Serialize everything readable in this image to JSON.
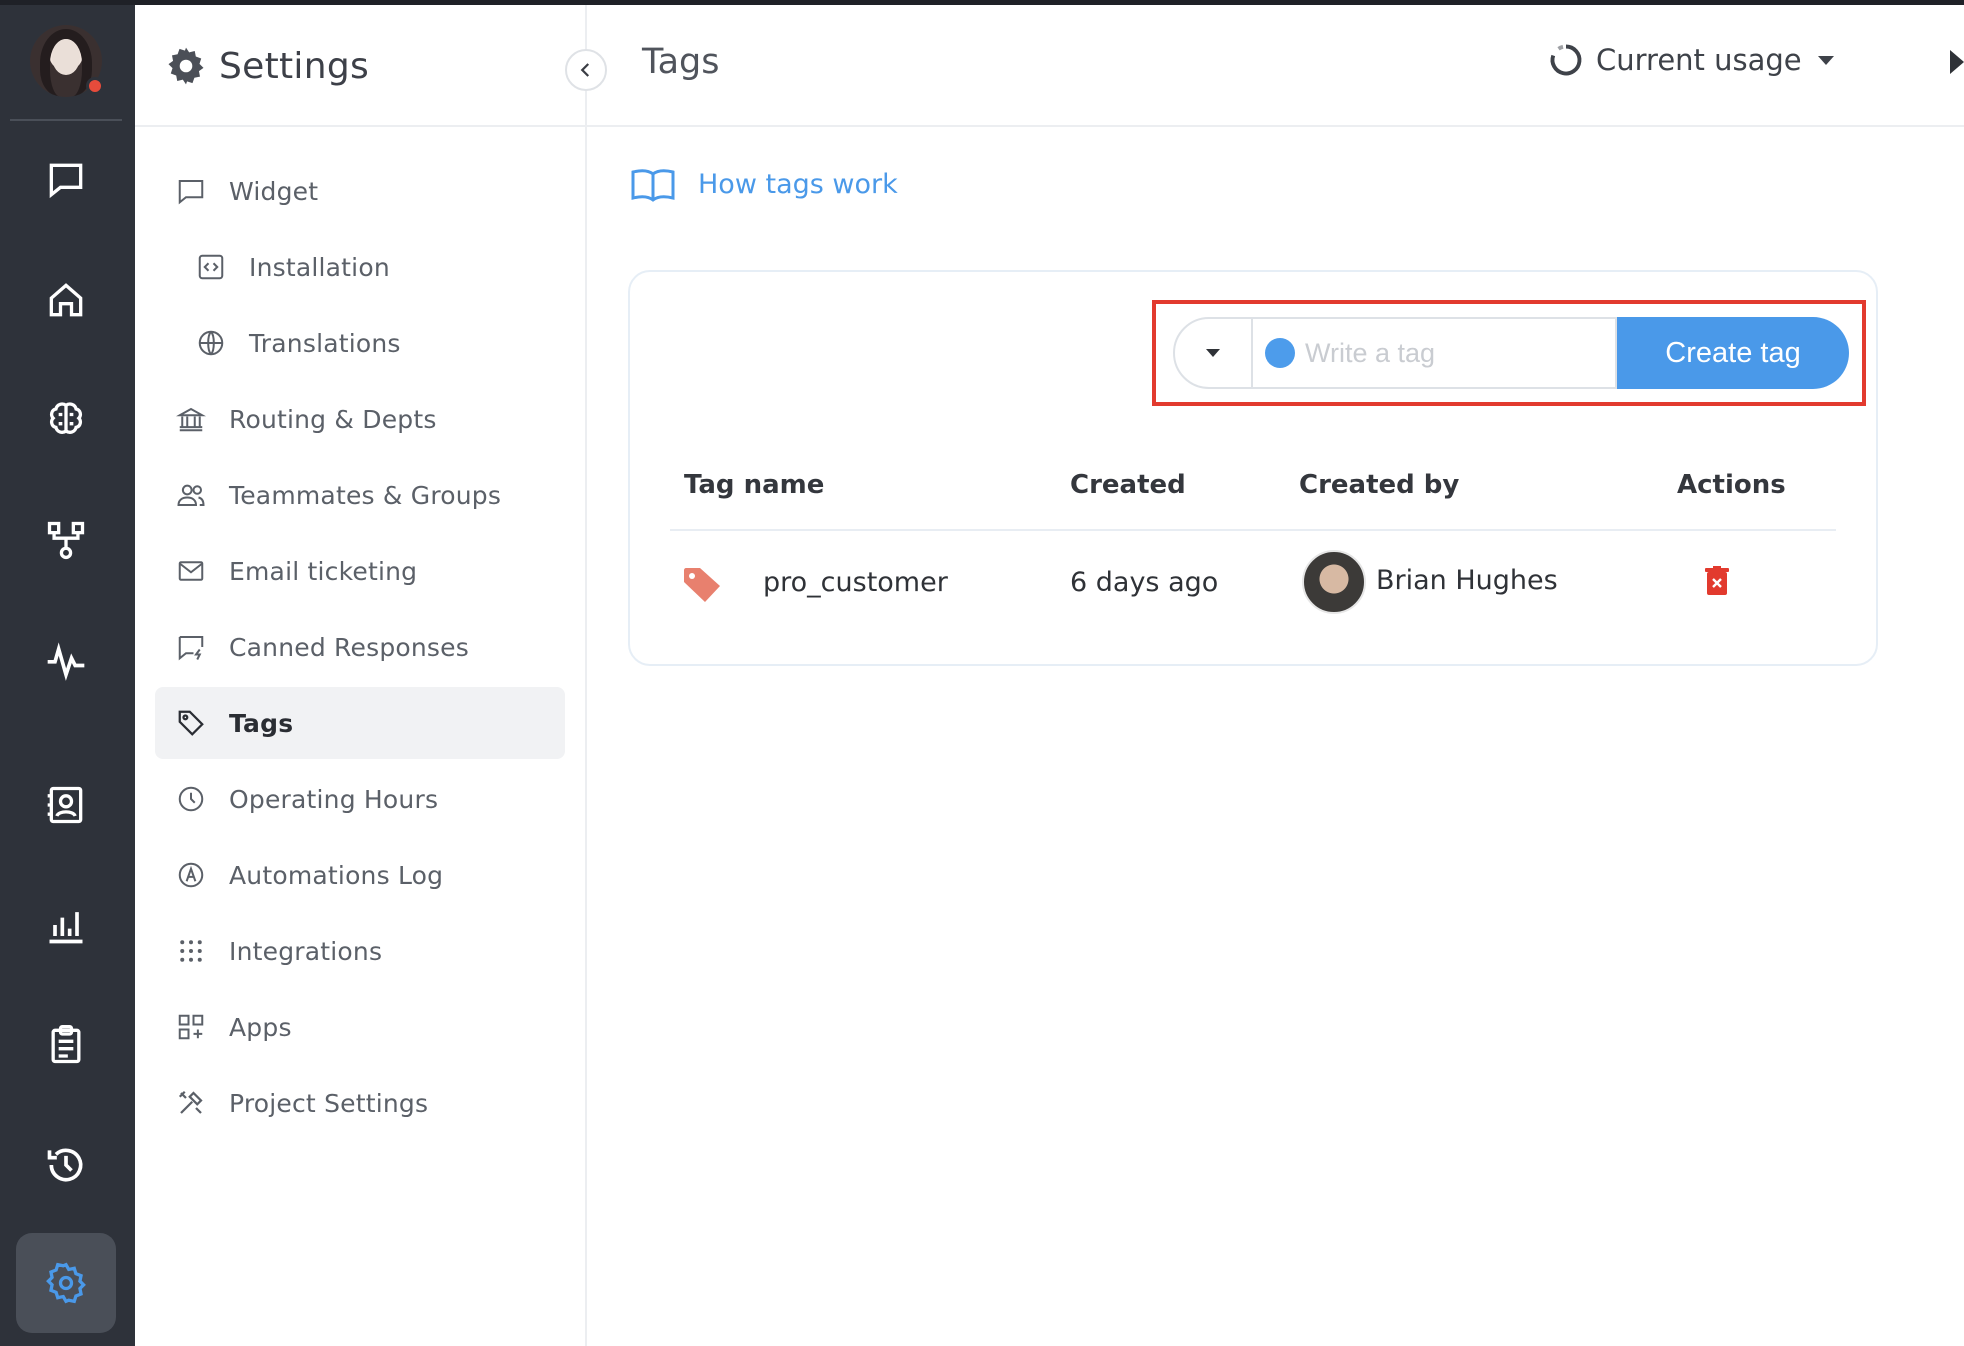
{
  "sidebar": {
    "title": "Settings",
    "items": [
      {
        "label": "Widget",
        "icon": "chat-square-icon"
      },
      {
        "label": "Installation",
        "icon": "code-icon"
      },
      {
        "label": "Translations",
        "icon": "globe-icon"
      },
      {
        "label": "Routing & Depts",
        "icon": "bank-icon"
      },
      {
        "label": "Teammates & Groups",
        "icon": "people-icon"
      },
      {
        "label": "Email ticketing",
        "icon": "envelope-icon"
      },
      {
        "label": "Canned Responses",
        "icon": "chat-lightning-icon"
      },
      {
        "label": "Tags",
        "icon": "tag-icon"
      },
      {
        "label": "Operating Hours",
        "icon": "clock-icon"
      },
      {
        "label": "Automations Log",
        "icon": "circle-a-icon"
      },
      {
        "label": "Integrations",
        "icon": "grid-dots-icon"
      },
      {
        "label": "Apps",
        "icon": "apps-icon"
      },
      {
        "label": "Project Settings",
        "icon": "tools-icon"
      }
    ]
  },
  "header": {
    "title": "Tags",
    "usage_label": "Current usage"
  },
  "help": {
    "label": "How tags work"
  },
  "form": {
    "placeholder": "Write a tag",
    "value": "",
    "create_label": "Create tag",
    "selected_color": "#4d9ceb"
  },
  "table": {
    "columns": [
      "Tag name",
      "Created",
      "Created by",
      "Actions"
    ],
    "rows": [
      {
        "tag": "pro_customer",
        "tag_color": "#e8806e",
        "created": "6 days ago",
        "created_by": "Brian Hughes"
      }
    ]
  },
  "colors": {
    "accent": "#4a99e9",
    "rail_bg": "#2e323a",
    "danger": "#e23a2e"
  }
}
